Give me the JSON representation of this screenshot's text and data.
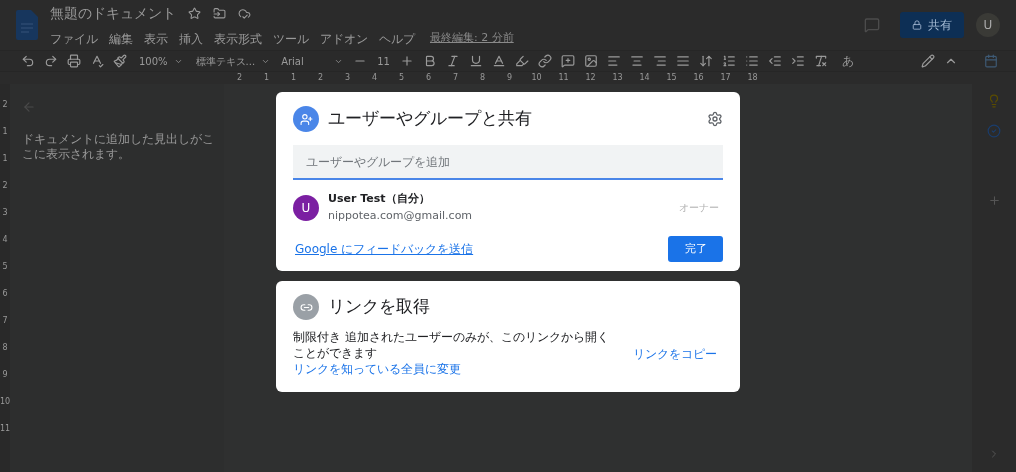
{
  "header": {
    "doc_title": "無題のドキュメント",
    "menus": [
      "ファイル",
      "編集",
      "表示",
      "挿入",
      "表示形式",
      "ツール",
      "アドオン",
      "ヘルプ"
    ],
    "last_edit": "最終編集: 2 分前",
    "share_button": "共有",
    "avatar": "U"
  },
  "toolbar": {
    "zoom": "100%",
    "style": "標準テキス...",
    "font": "Arial",
    "font_size": "11",
    "input_tool": "あ"
  },
  "ruler": {
    "horizontal": [
      "2",
      "1",
      "1",
      "2",
      "3",
      "4",
      "5",
      "6",
      "7",
      "8",
      "9",
      "10",
      "11",
      "12",
      "13",
      "14",
      "15",
      "16",
      "17",
      "18"
    ],
    "vertical": [
      "2",
      "1",
      "1",
      "2",
      "3",
      "4",
      "5",
      "6",
      "7",
      "8",
      "9",
      "10",
      "11"
    ]
  },
  "outline": {
    "hint": "ドキュメントに追加した見出しがここに表示されます。"
  },
  "share_dialog": {
    "title": "ユーザーやグループと共有",
    "add_placeholder": "ユーザーやグループを追加",
    "people": [
      {
        "initial": "U",
        "name": "User Test（自分）",
        "email": "nippotea.com@gmail.com",
        "role": "オーナー"
      }
    ],
    "feedback_link": "Google にフィードバックを送信",
    "done_button": "完了"
  },
  "link_dialog": {
    "title": "リンクを取得",
    "restriction": "制限付き",
    "description": "追加されたユーザーのみが、このリンクから開くことができます",
    "change_link": "リンクを知っている全員に変更",
    "copy_link": "リンクをコピー"
  }
}
